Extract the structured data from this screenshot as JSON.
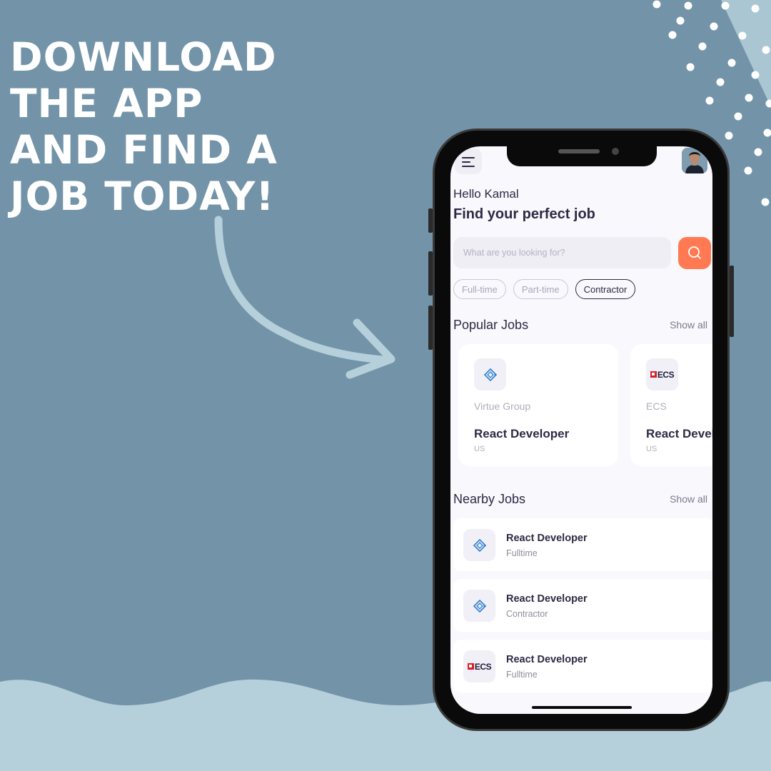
{
  "headline": [
    "DOWNLOAD",
    "THE APP",
    "AND FIND A",
    "JOB TODAY!"
  ],
  "colors": {
    "background": "#7394a8",
    "wave": "#b5d0da",
    "accent": "#ff7a52",
    "text_dark": "#2e2a44",
    "ecs_red": "#d81e2b"
  },
  "app": {
    "greeting": "Hello Kamal",
    "title": "Find your perfect job",
    "search": {
      "placeholder": "What are you looking for?"
    },
    "filters": [
      {
        "label": "Full-time",
        "active": false
      },
      {
        "label": "Part-time",
        "active": false
      },
      {
        "label": "Contractor",
        "active": true
      }
    ],
    "popular": {
      "title": "Popular Jobs",
      "show_all": "Show all",
      "cards": [
        {
          "company": "Virtue Group",
          "role": "React Developer",
          "location": "US",
          "logo": "virtue-group-logo"
        },
        {
          "company": "ECS",
          "role": "React Developer",
          "location": "US",
          "logo": "ecs-logo"
        }
      ]
    },
    "nearby": {
      "title": "Nearby Jobs",
      "show_all": "Show all",
      "items": [
        {
          "role": "React Developer",
          "type": "Fulltime",
          "logo": "virtue-group-logo"
        },
        {
          "role": "React Developer",
          "type": "Contractor",
          "logo": "virtue-group-logo"
        },
        {
          "role": "React Developer",
          "type": "Fulltime",
          "logo": "ecs-logo"
        }
      ]
    },
    "logo_text": {
      "ecs": "ECS"
    }
  }
}
